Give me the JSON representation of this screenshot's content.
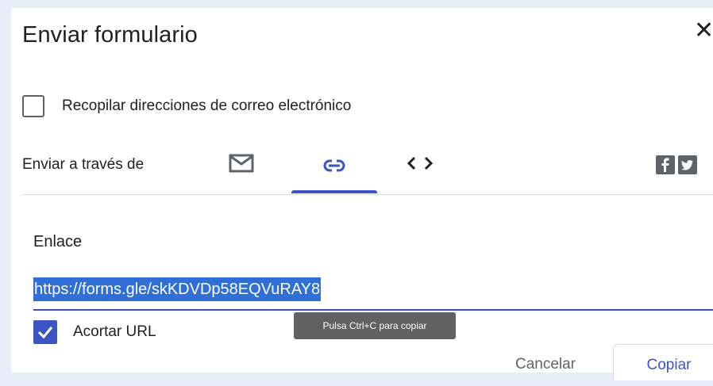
{
  "dialog": {
    "title": "Enviar formulario",
    "close_icon": "close-icon"
  },
  "collect_email": {
    "label": "Recopilar direcciones de correo electrónico",
    "checked": false
  },
  "send_via": {
    "label": "Enviar a través de",
    "tabs": [
      {
        "name": "email",
        "icon": "email-icon",
        "selected": false
      },
      {
        "name": "link",
        "icon": "link-icon",
        "selected": true
      },
      {
        "name": "embed",
        "icon": "code-icon",
        "selected": false
      }
    ],
    "social_icons": [
      "facebook-icon",
      "twitter-icon"
    ]
  },
  "link_section": {
    "label": "Enlace",
    "url": "https://forms.gle/skKDVDp58EQVuRAY8",
    "shorten_label": "Acortar URL",
    "shorten_checked": true,
    "tooltip": "Pulsa Ctrl+C para copiar"
  },
  "actions": {
    "cancel": "Cancelar",
    "copy": "Copiar"
  },
  "colors": {
    "accent": "#3c55c2",
    "selection": "#2f6fd6",
    "icon_gray": "#5f6368",
    "text": "#202124"
  }
}
